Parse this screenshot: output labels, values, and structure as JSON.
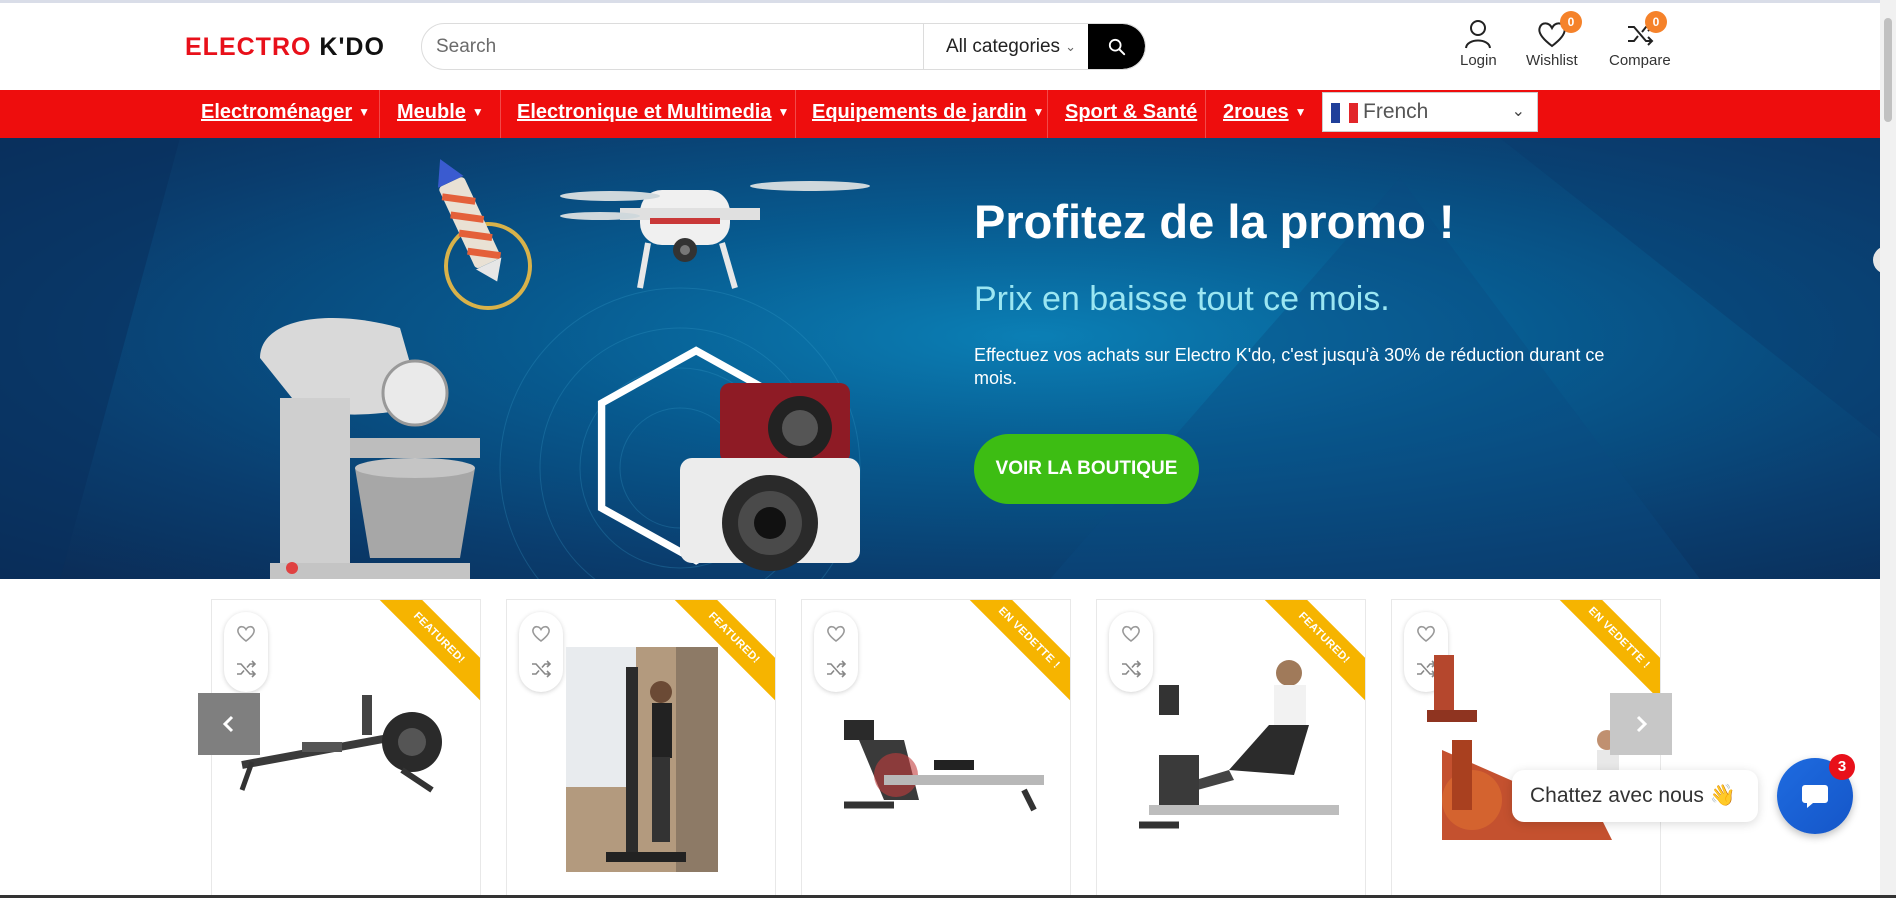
{
  "brand": {
    "logo_part1": "ELECTRO",
    "logo_part2": "K'DO",
    "accent": "#e8101a"
  },
  "search": {
    "placeholder": "Search",
    "category": "All categories"
  },
  "header_actions": {
    "login": "Login",
    "wishlist": "Wishlist",
    "wishlist_count": "0",
    "compare": "Compare",
    "compare_count": "0"
  },
  "nav": {
    "items": [
      {
        "label": "Electroménager",
        "dropdown": true
      },
      {
        "label": "Meuble",
        "dropdown": true
      },
      {
        "label": "Electronique et Multimedia",
        "dropdown": true
      },
      {
        "label": "Equipements de jardin",
        "dropdown": true
      },
      {
        "label": "Sport & Santé",
        "dropdown": false
      },
      {
        "label": "2roues",
        "dropdown": true
      }
    ],
    "language": "French",
    "bg_color": "#ee0d0d"
  },
  "hero": {
    "title": "Profitez de la promo !",
    "subtitle": "Prix en baisse tout ce mois.",
    "text": "Effectuez vos achats sur Electro K'do, c'est jusqu'à 30% de réduction durant ce mois.",
    "cta": "VOIR LA BOUTIQUE",
    "cta_color": "#3dbd13"
  },
  "products": [
    {
      "badge": "FEATURED!",
      "image": "rowing-machine-black"
    },
    {
      "badge": "FEATURED!",
      "image": "ski-erg-woman"
    },
    {
      "badge": "EN VEDETTE !",
      "image": "rowing-machine-compact"
    },
    {
      "badge": "FEATURED!",
      "image": "rowing-machine-woman"
    },
    {
      "badge": "EN VEDETTE !",
      "image": "wooden-water-rower"
    }
  ],
  "chat": {
    "label": "Chattez avec nous 👋",
    "unread": "3"
  }
}
